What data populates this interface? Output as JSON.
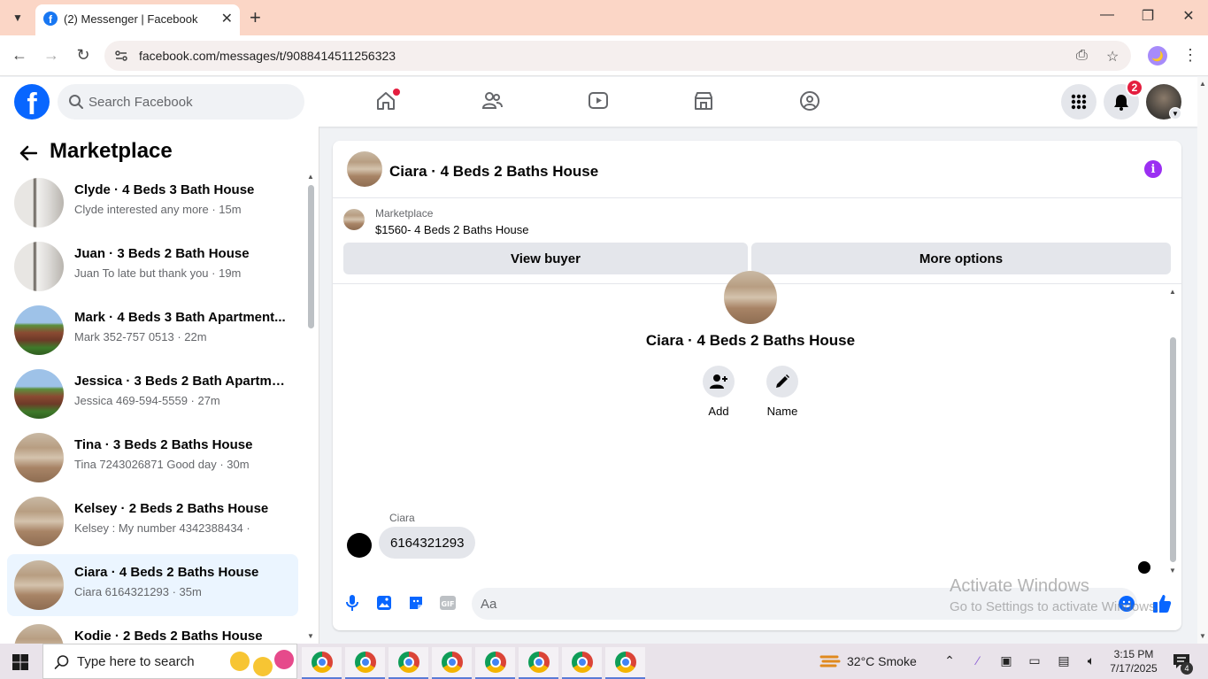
{
  "browser": {
    "tab_title": "(2) Messenger | Facebook",
    "url": "facebook.com/messages/t/9088414511256323",
    "colors": {
      "tab_strip": "#fbd6c6"
    }
  },
  "fb_nav": {
    "search_placeholder": "Search Facebook",
    "notification_count": "2",
    "nav_icons": [
      "home-icon",
      "friends-icon",
      "video-icon",
      "marketplace-icon",
      "groups-icon"
    ],
    "colors": {
      "brand": "#0866ff",
      "badge": "#e41e3f"
    }
  },
  "sidebar": {
    "title": "Marketplace",
    "conversations": [
      {
        "name": "Clyde · 4 Beds 3 Bath House",
        "preview": "Clyde interested any more · 15m",
        "thumb": "interior"
      },
      {
        "name": "Juan · 3 Beds 2 Bath House",
        "preview": "Juan To late but thank you · 19m",
        "thumb": "interior"
      },
      {
        "name": "Mark · 4 Beds 3 Bath Apartment...",
        "preview": "Mark 352-757 0513 · 22m",
        "thumb": "apartment"
      },
      {
        "name": "Jessica · 3 Beds 2 Bath Apartme...",
        "preview": "Jessica 469-594-5559 · 27m",
        "thumb": "apartment"
      },
      {
        "name": "Tina · 3 Beds 2 Baths House",
        "preview": "Tina 7243026871 Good day · 30m",
        "thumb": "house"
      },
      {
        "name": "Kelsey · 2 Beds 2 Baths House",
        "preview": "Kelsey : My number 4342388434 ·",
        "thumb": "house"
      },
      {
        "name": "Ciara · 4 Beds 2 Baths House",
        "preview": "Ciara 6164321293 · 35m",
        "thumb": "house",
        "active": true
      },
      {
        "name": "Kodie · 2 Beds 2 Baths House",
        "preview": "",
        "thumb": "house"
      }
    ]
  },
  "chat": {
    "header_title": "Ciara · 4 Beds 2 Baths House",
    "marketplace_label": "Marketplace",
    "listing": "$1560- 4 Beds 2 Baths House",
    "view_buyer_label": "View buyer",
    "more_options_label": "More options",
    "profile_name": "Ciara · 4 Beds 2 Baths House",
    "add_label": "Add",
    "name_label": "Name",
    "sender": "Ciara",
    "message": "6164321293",
    "composer_placeholder": "Aa",
    "colors": {
      "info": "#9b2ff2",
      "accent": "#0866ff"
    }
  },
  "watermark": {
    "line1": "Activate Windows",
    "line2": "Go to Settings to activate Windows."
  },
  "taskbar": {
    "search_placeholder": "Type here to search",
    "weather": "32°C  Smoke",
    "time": "3:15 PM",
    "date": "7/17/2025",
    "notification_count": "4"
  }
}
